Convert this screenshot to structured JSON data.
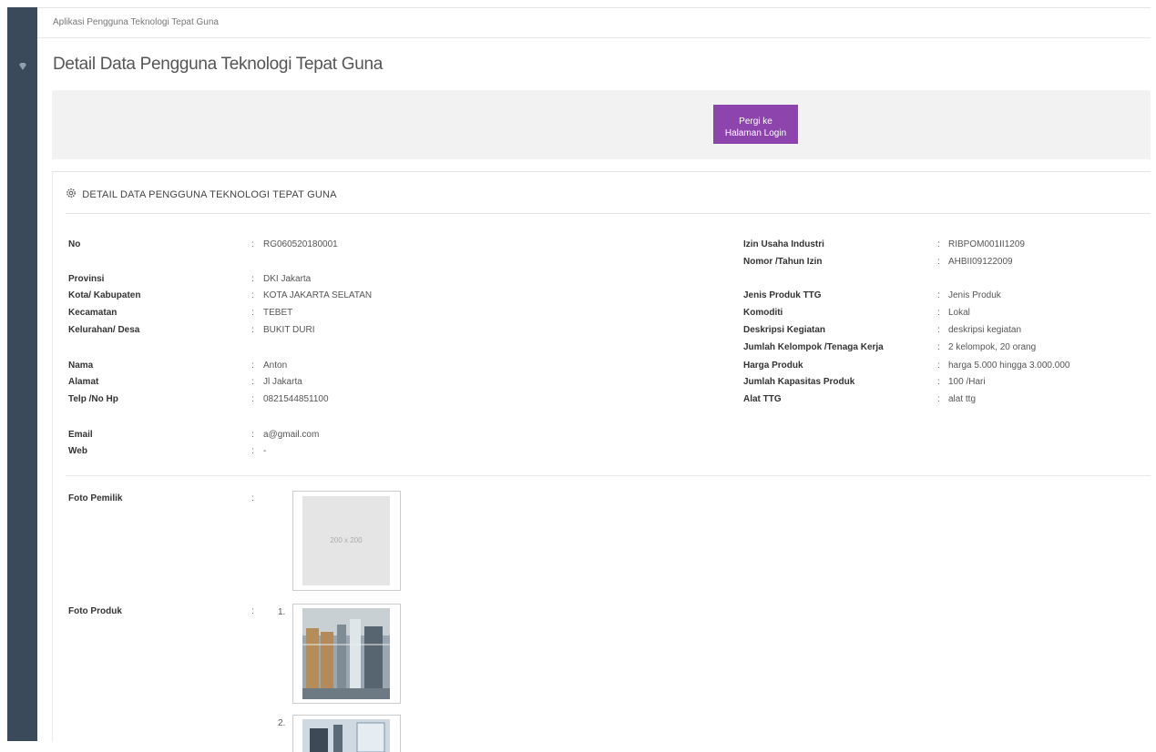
{
  "app": {
    "title": "Aplikasi Pengguna Teknologi Tepat Guna"
  },
  "page": {
    "title": "Detail Data Pengguna Teknologi Tepat Guna"
  },
  "actions": {
    "login_button_line1": "Pergi ke",
    "login_button_line2": "Halaman Login"
  },
  "panel": {
    "heading": "DETAIL DATA PENGGUNA TEKNOLOGI TEPAT GUNA"
  },
  "separator": ":",
  "left": [
    {
      "label": "No",
      "value": "RG060520180001"
    },
    {
      "label": "Provinsi",
      "value": "DKI Jakarta"
    },
    {
      "label": "Kota/ Kabupaten",
      "value": "KOTA JAKARTA SELATAN"
    },
    {
      "label": "Kecamatan",
      "value": "TEBET"
    },
    {
      "label": "Kelurahan/ Desa",
      "value": "BUKIT DURI"
    },
    {
      "label": "Nama",
      "value": "Anton"
    },
    {
      "label": "Alamat",
      "value": "Jl Jakarta"
    },
    {
      "label": "Telp /No Hp",
      "value": "0821544851100"
    },
    {
      "label": "Email",
      "value": "a@gmail.com"
    },
    {
      "label": "Web",
      "value": "-"
    }
  ],
  "right": [
    {
      "label": "Izin Usaha Industri",
      "value": "RIBPOM001II1209"
    },
    {
      "label": "Nomor /Tahun Izin",
      "value": "AHBII09122009"
    },
    {
      "label": "Jenis Produk TTG",
      "value": "Jenis Produk"
    },
    {
      "label": "Komoditi",
      "value": "Lokal"
    },
    {
      "label": "Deskripsi Kegiatan",
      "value": "deskripsi kegiatan"
    },
    {
      "label": "Jumlah Kelompok /Tenaga Kerja",
      "value": "2 kelompok, 20 orang"
    },
    {
      "label": "Harga Produk",
      "value": "harga 5.000 hingga 3.000.000"
    },
    {
      "label": "Jumlah Kapasitas Produk",
      "value": "100 /Hari"
    },
    {
      "label": "Alat TTG",
      "value": "alat ttg"
    }
  ],
  "photos": {
    "owner_label": "Foto Pemilik",
    "owner_placeholder": "200 x 200",
    "product_label": "Foto Produk",
    "product_items": [
      "1.",
      "2."
    ]
  },
  "colors": {
    "sidebar": "#3b4a5a",
    "accent": "#8e44ad"
  }
}
